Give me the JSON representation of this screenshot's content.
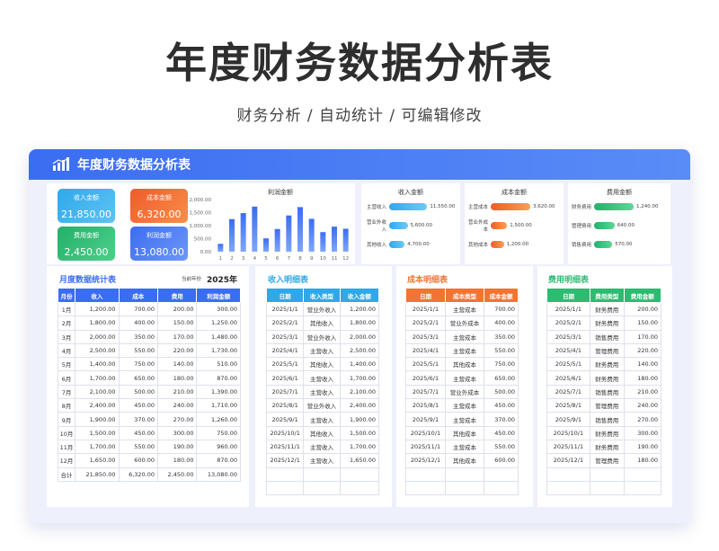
{
  "page": {
    "title": "年度财务数据分析表",
    "subtitle": "财务分析 / 自动统计 / 可编辑修改"
  },
  "card": {
    "header_title": "年度财务数据分析表"
  },
  "kpis": [
    {
      "label": "收入金额",
      "value": "21,850.00",
      "color": "#2fa8ea"
    },
    {
      "label": "成本金额",
      "value": "6,320.00",
      "color": "#f27433"
    },
    {
      "label": "费用金额",
      "value": "2,450.00",
      "color": "#2dbb72"
    },
    {
      "label": "利润金额",
      "value": "13,080.00",
      "color": "#4a7df5"
    }
  ],
  "chart_data": [
    {
      "type": "bar",
      "title": "利润金额",
      "categories": [
        "1",
        "2",
        "3",
        "4",
        "5",
        "6",
        "7",
        "8",
        "9",
        "10",
        "11",
        "12"
      ],
      "values": [
        300,
        1250,
        1480,
        1730,
        510,
        870,
        1390,
        1710,
        1260,
        750,
        960,
        880
      ],
      "ylim": [
        0,
        2000
      ],
      "yticks": [
        "2,000.00",
        "1,500.00",
        "1,000.00",
        "500.00",
        "0.00"
      ],
      "color": "#3b6df2"
    },
    {
      "type": "bar",
      "title": "收入金额",
      "categories": [
        "主营收入",
        "营业外收入",
        "其他收入"
      ],
      "values": [
        11550,
        5600,
        4700
      ],
      "labels": [
        "11,550.00",
        "5,600.00",
        "4,700.00"
      ],
      "max": 12000,
      "color": "#2fa8ea"
    },
    {
      "type": "bar",
      "title": "成本金额",
      "categories": [
        "主营成本",
        "营业外成本",
        "其他成本"
      ],
      "values": [
        3620,
        1500,
        1200
      ],
      "labels": [
        "3,620.00",
        "1,500.00",
        "1,200.00"
      ],
      "max": 3620,
      "color": "#f27433"
    },
    {
      "type": "bar",
      "title": "费用金额",
      "categories": [
        "财务费用",
        "管理费用",
        "销售费用"
      ],
      "values": [
        1240,
        640,
        570
      ],
      "labels": [
        "1,240.00",
        "640.00",
        "570.00"
      ],
      "max": 1240,
      "color": "#2dbb72"
    }
  ],
  "monthly": {
    "title": "月度数据统计表",
    "year_label": "当前年份",
    "year": "2025年",
    "headers": [
      "月份",
      "收入",
      "成本",
      "费用",
      "利润金额"
    ],
    "rows": [
      [
        "1月",
        "1,200.00",
        "700.00",
        "200.00",
        "300.00"
      ],
      [
        "2月",
        "1,800.00",
        "400.00",
        "150.00",
        "1,250.00"
      ],
      [
        "3月",
        "2,000.00",
        "350.00",
        "170.00",
        "1,480.00"
      ],
      [
        "4月",
        "2,500.00",
        "550.00",
        "220.00",
        "1,730.00"
      ],
      [
        "5月",
        "1,400.00",
        "750.00",
        "140.00",
        "510.00"
      ],
      [
        "6月",
        "1,700.00",
        "650.00",
        "180.00",
        "870.00"
      ],
      [
        "7月",
        "2,100.00",
        "500.00",
        "210.00",
        "1,390.00"
      ],
      [
        "8月",
        "2,400.00",
        "450.00",
        "240.00",
        "1,710.00"
      ],
      [
        "9月",
        "1,900.00",
        "370.00",
        "270.00",
        "1,260.00"
      ],
      [
        "10月",
        "1,500.00",
        "450.00",
        "300.00",
        "750.00"
      ],
      [
        "11月",
        "1,700.00",
        "550.00",
        "190.00",
        "960.00"
      ],
      [
        "12月",
        "1,650.00",
        "600.00",
        "180.00",
        "870.00"
      ],
      [
        "合计",
        "21,850.00",
        "6,320.00",
        "2,450.00",
        "13,080.00"
      ]
    ],
    "color": "#3b6df2"
  },
  "income": {
    "title": "收入明细表",
    "headers": [
      "日期",
      "收入类型",
      "收入金额"
    ],
    "rows": [
      [
        "2025/1/1",
        "营业外收入",
        "1,200.00"
      ],
      [
        "2025/2/1",
        "其他收入",
        "1,800.00"
      ],
      [
        "2025/3/1",
        "营业外收入",
        "2,000.00"
      ],
      [
        "2025/4/1",
        "主营收入",
        "2,500.00"
      ],
      [
        "2025/5/1",
        "其他收入",
        "1,400.00"
      ],
      [
        "2025/6/1",
        "主营收入",
        "1,700.00"
      ],
      [
        "2025/7/1",
        "主营收入",
        "2,100.00"
      ],
      [
        "2025/8/1",
        "营业外收入",
        "2,400.00"
      ],
      [
        "2025/9/1",
        "主营收入",
        "1,900.00"
      ],
      [
        "2025/10/1",
        "其他收入",
        "1,500.00"
      ],
      [
        "2025/11/1",
        "主营收入",
        "1,700.00"
      ],
      [
        "2025/12/1",
        "主营收入",
        "1,650.00"
      ],
      [
        "",
        "",
        ""
      ],
      [
        "",
        "",
        ""
      ]
    ],
    "color": "#2fa8ea"
  },
  "cost": {
    "title": "成本明细表",
    "headers": [
      "日期",
      "成本类型",
      "成本金额"
    ],
    "rows": [
      [
        "2025/1/1",
        "主营成本",
        "700.00"
      ],
      [
        "2025/2/1",
        "营业外成本",
        "400.00"
      ],
      [
        "2025/3/1",
        "主营成本",
        "350.00"
      ],
      [
        "2025/4/1",
        "主营成本",
        "550.00"
      ],
      [
        "2025/5/1",
        "其他成本",
        "750.00"
      ],
      [
        "2025/6/1",
        "主营成本",
        "650.00"
      ],
      [
        "2025/7/1",
        "营业外成本",
        "500.00"
      ],
      [
        "2025/8/1",
        "主营成本",
        "450.00"
      ],
      [
        "2025/9/1",
        "主营成本",
        "370.00"
      ],
      [
        "2025/10/1",
        "其他成本",
        "450.00"
      ],
      [
        "2025/11/1",
        "主营成本",
        "550.00"
      ],
      [
        "2025/12/1",
        "其他成本",
        "600.00"
      ],
      [
        "",
        "",
        ""
      ],
      [
        "",
        "",
        ""
      ]
    ],
    "color": "#f27433"
  },
  "expense": {
    "title": "费用明细表",
    "headers": [
      "日期",
      "费用类型",
      "费用金额"
    ],
    "rows": [
      [
        "2025/1/1",
        "财务费用",
        "200.00"
      ],
      [
        "2025/2/1",
        "财务费用",
        "150.00"
      ],
      [
        "2025/3/1",
        "销售费用",
        "170.00"
      ],
      [
        "2025/4/1",
        "管理费用",
        "220.00"
      ],
      [
        "2025/5/1",
        "财务费用",
        "140.00"
      ],
      [
        "2025/6/1",
        "财务费用",
        "180.00"
      ],
      [
        "2025/7/1",
        "销售费用",
        "210.00"
      ],
      [
        "2025/8/1",
        "管理费用",
        "240.00"
      ],
      [
        "2025/9/1",
        "销售费用",
        "270.00"
      ],
      [
        "2025/10/1",
        "财务费用",
        "300.00"
      ],
      [
        "2025/11/1",
        "财务费用",
        "190.00"
      ],
      [
        "2025/12/1",
        "管理费用",
        "180.00"
      ],
      [
        "",
        "",
        ""
      ],
      [
        "",
        "",
        ""
      ]
    ],
    "color": "#2dbb72"
  }
}
